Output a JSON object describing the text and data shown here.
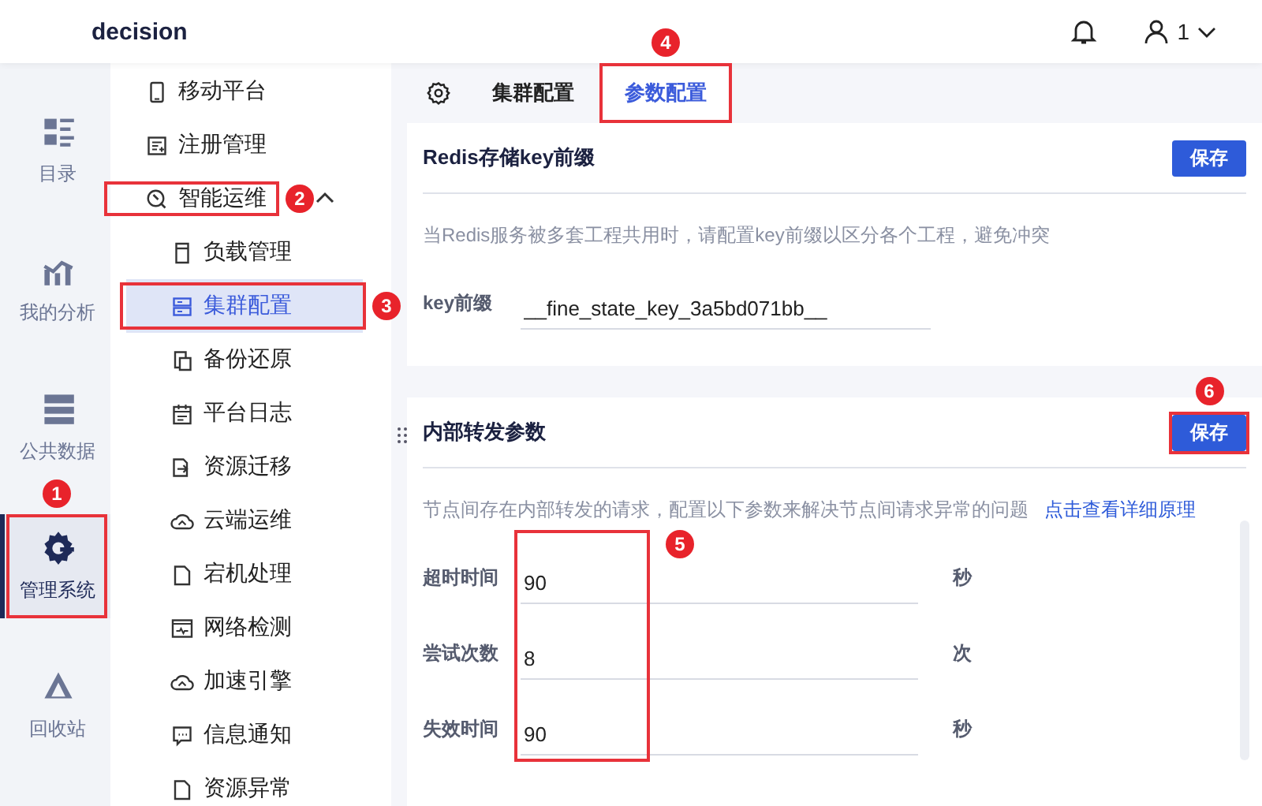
{
  "header": {
    "title": "decision",
    "user": "1"
  },
  "rail": [
    {
      "label": "目录",
      "selected": false
    },
    {
      "label": "我的分析",
      "selected": false
    },
    {
      "label": "公共数据",
      "selected": false
    },
    {
      "label": "管理系统",
      "selected": true,
      "step": "1"
    },
    {
      "label": "回收站",
      "selected": false
    }
  ],
  "menu": [
    {
      "label": "移动平台",
      "selected": false
    },
    {
      "label": "注册管理",
      "selected": false
    },
    {
      "label": "智能运维",
      "selected": false,
      "step": "2",
      "expanded": true,
      "children": [
        {
          "label": "负载管理",
          "selected": false
        },
        {
          "label": "集群配置",
          "selected": true,
          "step": "3"
        },
        {
          "label": "备份还原",
          "selected": false
        },
        {
          "label": "平台日志",
          "selected": false
        },
        {
          "label": "资源迁移",
          "selected": false
        },
        {
          "label": "云端运维",
          "selected": false
        },
        {
          "label": "宕机处理",
          "selected": false
        },
        {
          "label": "网络检测",
          "selected": false
        },
        {
          "label": "加速引擎",
          "selected": false
        },
        {
          "label": "信息通知",
          "selected": false
        },
        {
          "label": "资源异常",
          "selected": false
        }
      ]
    }
  ],
  "tabs": [
    {
      "label": "集群配置",
      "selected": false
    },
    {
      "label": "参数配置",
      "selected": true,
      "step": "4"
    }
  ],
  "panels": [
    {
      "title": "Redis存储key前缀",
      "save": "保存",
      "description": "当Redis服务被多套工程共用时，请配置key前缀以区分各个工程，避免冲突",
      "fields": [
        {
          "label": "key前缀",
          "value": "__fine_state_key_3a5bd071bb__"
        }
      ]
    },
    {
      "title": "内部转发参数",
      "save": "保存",
      "save_step": "6",
      "description": "节点间存在内部转发的请求，配置以下参数来解决节点间请求异常的问题",
      "link": "点击查看详细原理",
      "fields_step": "5",
      "fields": [
        {
          "label": "超时时间",
          "value": "90",
          "unit": "秒"
        },
        {
          "label": "尝试次数",
          "value": "8",
          "unit": "次"
        },
        {
          "label": "失效时间",
          "value": "90",
          "unit": "秒"
        }
      ]
    }
  ]
}
